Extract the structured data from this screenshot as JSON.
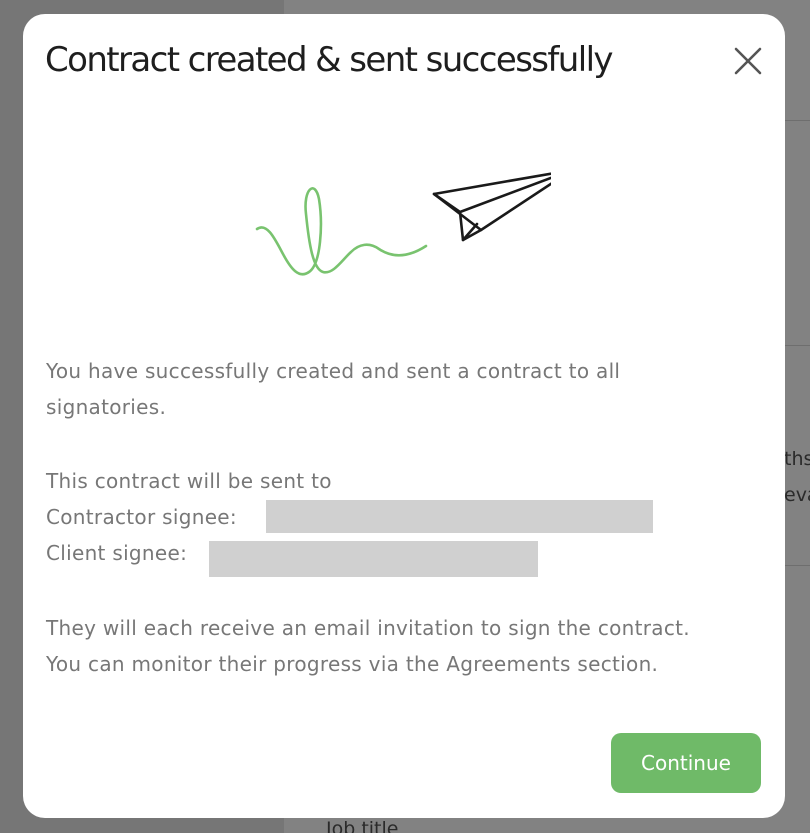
{
  "background": {
    "partial_text_right_1": "ths",
    "partial_text_right_2": "eva",
    "partial_text_bottom": "Job title"
  },
  "modal": {
    "title": "Contract created & sent successfully",
    "close_icon": "close-icon",
    "illustration": "paper-plane-with-signature",
    "message_line1": "You have successfully created and sent a contract to all",
    "message_line2": "signatories.",
    "sent_to_label": "This contract will be sent to",
    "contractor_label": "Contractor signee:",
    "contractor_value": "",
    "client_label": "Client signee:",
    "client_value": "",
    "info_line1": "They will each receive an email invitation to sign the contract.",
    "info_line2": "You can monitor their progress via the Agreements section.",
    "continue_label": "Continue"
  },
  "colors": {
    "accent_green": "#6fba68",
    "overlay": "#7a7a7a",
    "redaction": "#d0d0d0"
  }
}
